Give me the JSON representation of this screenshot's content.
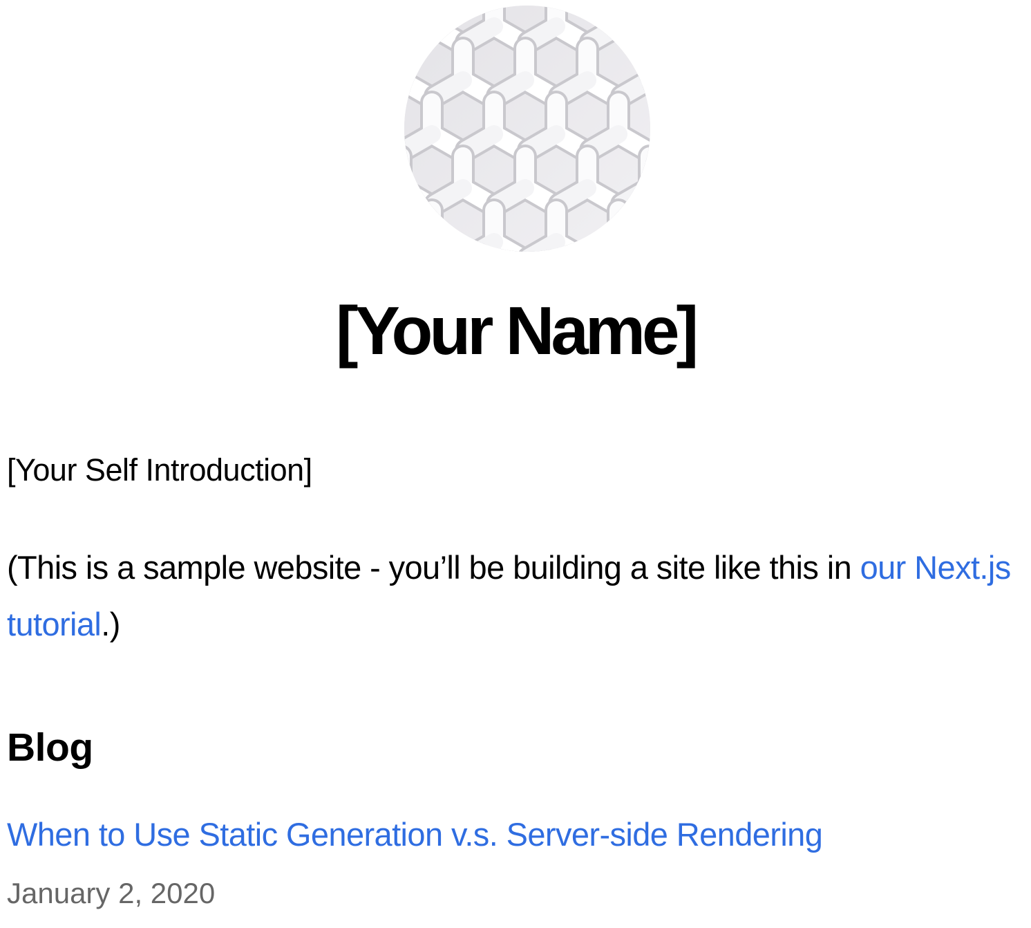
{
  "header": {
    "avatar_alt": "[Your Name]",
    "title": "[Your Name]"
  },
  "intro": {
    "text": "[Your Self Introduction]",
    "note_prefix": "(This is a sample website - you’ll be building a site like this in ",
    "note_link": "our Next.js tutorial",
    "note_suffix": ".)"
  },
  "blog": {
    "heading": "Blog",
    "posts": [
      {
        "title": "When to Use Static Generation v.s. Server-side Rendering",
        "date": "January 2, 2020"
      }
    ]
  },
  "colors": {
    "link": "#2f6de1",
    "date": "#666666",
    "text": "#000000"
  }
}
